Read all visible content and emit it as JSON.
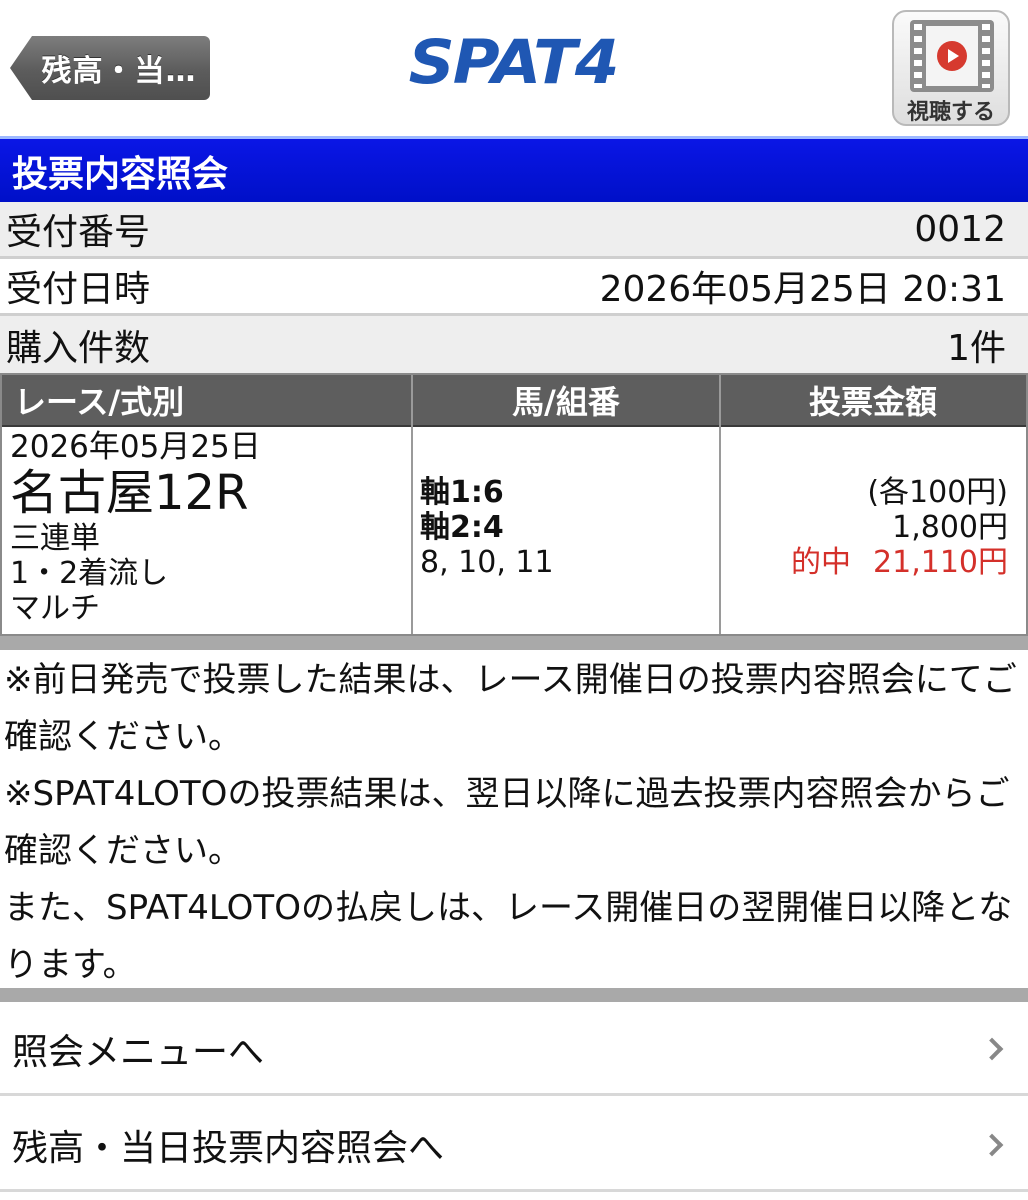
{
  "header": {
    "back_label": "残高・当…",
    "logo_text": "SPAT4",
    "watch_label": "視聴する"
  },
  "title": "投票内容照会",
  "info": {
    "receipt_no_label": "受付番号",
    "receipt_no_value": "0012",
    "receipt_datetime_label": "受付日時",
    "receipt_datetime_value": "2026年05月25日 20:31",
    "purchase_count_label": "購入件数",
    "purchase_count_value": "1件"
  },
  "table": {
    "headers": [
      "レース/式別",
      "馬/組番",
      "投票金額"
    ],
    "row": {
      "date": "2026年05月25日",
      "track": "名古屋12R",
      "bet_type": "三連単",
      "method": "1・2着流し",
      "multi": "マルチ",
      "axis1": "軸1:6",
      "axis2": "軸2:4",
      "combos": "8, 10, 11",
      "unit_amount": "(各100円)",
      "total_amount": "1,800円",
      "hit_label": "的中",
      "hit_amount": "21,110円"
    }
  },
  "notes": [
    "※前日発売で投票した結果は、レース開催日の投票内容照会にてご確認ください。",
    "※SPAT4LOTOの投票結果は、翌日以降に過去投票内容照会からご確認ください。",
    "また、SPAT4LOTOの払戻しは、レース開催日の翌開催日以降となります。"
  ],
  "menu": [
    {
      "label": "照会メニューへ"
    },
    {
      "label": "残高・当日投票内容照会へ"
    }
  ],
  "colors": {
    "title_bar": "#0010c8",
    "hit_red": "#d4302a",
    "logo_blue": "#1f57b3"
  }
}
